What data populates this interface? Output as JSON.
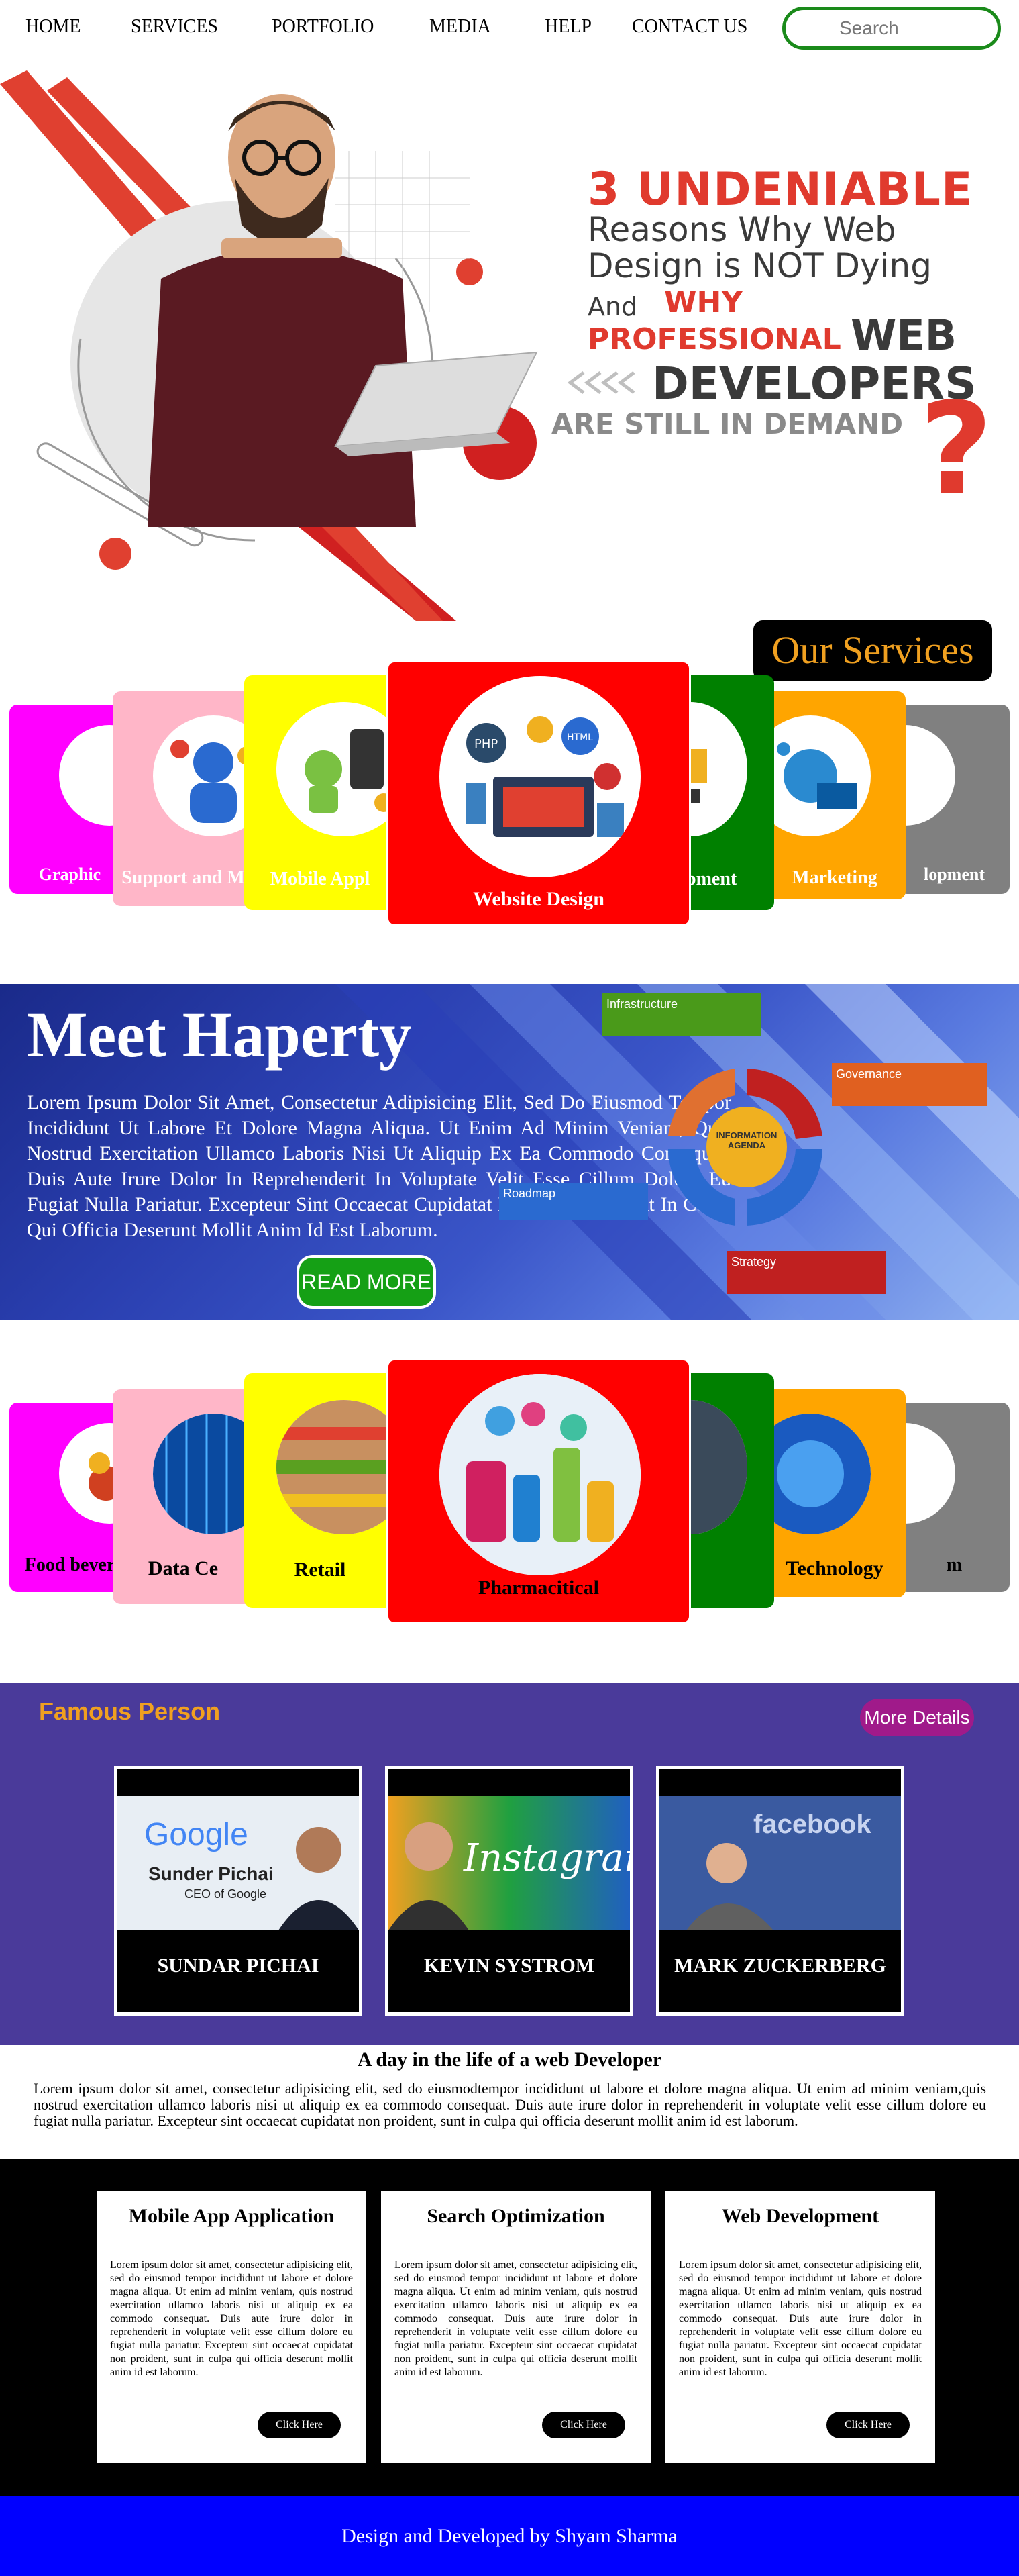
{
  "nav": {
    "items": [
      "HOME",
      "SERVICES",
      "PORTFOLIO",
      "MEDIA",
      "HELP",
      "CONTACT US"
    ],
    "search_placeholder": "Search"
  },
  "hero": {
    "line1": "3 UNDENIABLE",
    "line2": "Reasons Why Web",
    "line3": "Design is NOT Dying",
    "line4a": "And",
    "line4b": "WHY",
    "line5a": "PROFESSIONAL",
    "line5b": "WEB",
    "line6": "DEVELOPERS",
    "line7": "ARE STILL IN DEMAND",
    "qmark": "?"
  },
  "services": {
    "heading": "Our Services",
    "cards": [
      {
        "label": "Graphic",
        "color": "#ff00ff"
      },
      {
        "label": "Support and M",
        "color": "#ffb6c8"
      },
      {
        "label": "Mobile Appl",
        "color": "#ffff00"
      },
      {
        "label": "Website Design",
        "color": "#ff0000"
      },
      {
        "label": "opment",
        "color": "#008000"
      },
      {
        "label": "Marketing",
        "color": "#ffa500"
      },
      {
        "label": "lopment",
        "color": "#808080"
      }
    ]
  },
  "meet": {
    "title": "Meet Haperty",
    "text": "Lorem Ipsum Dolor Sit Amet, Consectetur Adipisicing Elit, Sed Do Eiusmod Tempor Incididunt Ut Labore Et Dolore Magna Aliqua. Ut Enim Ad Minim Veniam, Quis Nostrud Exercitation Ullamco Laboris Nisi Ut Aliquip Ex Ea Commodo Consequat. Duis Aute Irure Dolor In Reprehenderit In Voluptate Velit Esse Cillum Dolore Eu Fugiat Nulla Pariatur. Excepteur Sint Occaecat Cupidatat Non Proident, Sunt In Culpa Qui Officia Deserunt Mollit Anim Id Est Laborum.",
    "button": "READ MORE",
    "diagram": {
      "infrastructure": "Infrastructure",
      "governance": "Governance",
      "roadmap": "Roadmap",
      "strategy": "Strategy",
      "center": "INFORMATION AGENDA"
    }
  },
  "industries": {
    "cards": [
      {
        "label": "Food bever",
        "color": "#ff00ff"
      },
      {
        "label": "Data Ce",
        "color": "#ffb6c8"
      },
      {
        "label": "Retail",
        "color": "#ffff00"
      },
      {
        "label": "Pharmacitical",
        "color": "#ff0000"
      },
      {
        "label": "",
        "color": "#008000"
      },
      {
        "label": "Technology",
        "color": "#ffa500"
      },
      {
        "label": "m",
        "color": "#808080"
      }
    ]
  },
  "famous": {
    "title": "Famous Person",
    "button": "More Details",
    "people": [
      {
        "name": "SUNDAR PICHAI",
        "brand": "Google",
        "caption1": "Sunder Pichai",
        "caption2": "CEO of Google"
      },
      {
        "name": "KEVIN SYSTROM",
        "brand": "Instagram"
      },
      {
        "name": "MARK ZUCKERBERG",
        "brand": "facebook"
      }
    ]
  },
  "day": {
    "title": "A day in the life of a web Developer",
    "text": "Lorem ipsum dolor sit amet, consectetur adipisicing elit, sed do eiusmodtempor incididunt ut labore et dolore magna aliqua. Ut enim ad minim veniam,quis nostrud exercitation ullamco laboris nisi ut aliquip ex ea commodo consequat. Duis aute irure dolor in reprehenderit in voluptate velit esse cillum dolore eu fugiat nulla pariatur. Excepteur sint occaecat cupidatat non proident, sunt in culpa qui officia deserunt mollit anim id est laborum."
  },
  "features": [
    {
      "title": "Mobile App Application",
      "text": "Lorem ipsum dolor sit amet, consectetur adipisicing elit, sed do eiusmod tempor incididunt ut labore et dolore magna aliqua. Ut enim ad minim veniam, quis nostrud exercitation ullamco laboris nisi ut aliquip ex ea commodo consequat. Duis aute irure dolor in reprehenderit in voluptate velit esse cillum dolore eu fugiat nulla pariatur. Excepteur sint occaecat cupidatat non proident, sunt in culpa qui officia deserunt mollit anim id est laborum.",
      "button": "Click Here"
    },
    {
      "title": "Search Optimization",
      "text": "Lorem ipsum dolor sit amet, consectetur adipisicing elit, sed do eiusmod tempor incididunt ut labore et dolore magna aliqua. Ut enim ad minim veniam, quis nostrud exercitation ullamco laboris nisi ut aliquip ex ea commodo consequat. Duis aute irure dolor in reprehenderit in voluptate velit esse cillum dolore eu fugiat nulla pariatur. Excepteur sint occaecat cupidatat non proident, sunt in culpa qui officia deserunt mollit anim id est laborum.",
      "button": "Click Here"
    },
    {
      "title": "Web Development",
      "text": "Lorem ipsum dolor sit amet, consectetur adipisicing elit, sed do eiusmod tempor incididunt ut labore et dolore magna aliqua. Ut enim ad minim veniam, quis nostrud exercitation ullamco laboris nisi ut aliquip ex ea commodo consequat. Duis aute irure dolor in reprehenderit in voluptate velit esse cillum dolore eu fugiat nulla pariatur. Excepteur sint occaecat cupidatat non proident, sunt in culpa qui officia deserunt mollit anim id est laborum.",
      "button": "Click Here"
    }
  ],
  "footer": {
    "text": "Design and Developed by Shyam Sharma"
  }
}
